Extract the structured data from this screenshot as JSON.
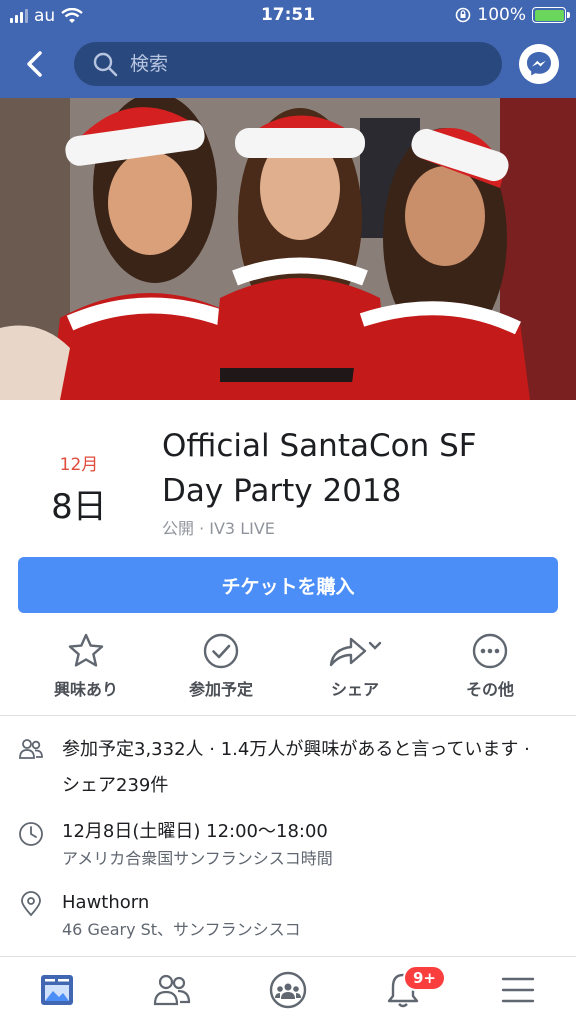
{
  "status_bar": {
    "carrier": "au",
    "time": "17:51",
    "battery_percent": "100%",
    "battery_level": 1.0
  },
  "nav": {
    "search_placeholder": "検索"
  },
  "event": {
    "month": "12月",
    "day": "8日",
    "title": "Official SantaCon SF Day Party 2018",
    "subtitle": "公開 · IV3 LIVE"
  },
  "ticket_button": "チケットを購入",
  "actions": [
    {
      "label": "興味あり",
      "icon": "star-icon"
    },
    {
      "label": "参加予定",
      "icon": "check-circle-icon"
    },
    {
      "label": "シェア",
      "icon": "share-icon"
    },
    {
      "label": "その他",
      "icon": "more-icon"
    }
  ],
  "info": {
    "attendance": "参加予定3,332人 · 1.4万人が興味があると言っています · シェア239件",
    "datetime": "12月8日(土曜日) 12:00〜18:00",
    "timezone": "アメリカ合衆国サンフランシスコ時間",
    "venue": "Hawthorn",
    "address": "46 Geary St、サンフランシスコ"
  },
  "tabbar": {
    "notifications_badge": "9+",
    "active_color": "#4267b2"
  },
  "colors": {
    "brand": "#4267b2",
    "button": "#4c8ef7",
    "date_red": "#e04c3b"
  }
}
